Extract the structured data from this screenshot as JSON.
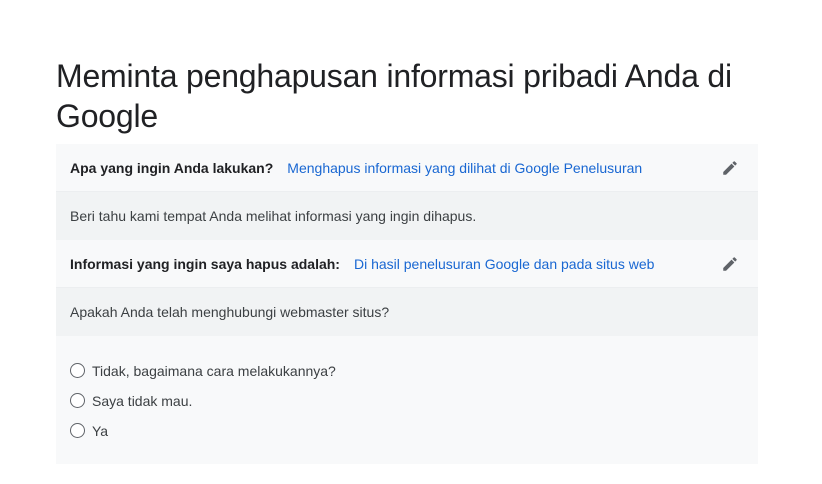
{
  "page": {
    "title": "Meminta penghapusan informasi pribadi Anda di Google"
  },
  "steps": [
    {
      "label": "Apa yang ingin Anda lakukan?",
      "value": "Menghapus informasi yang dilihat di Google Penelusuran",
      "edit_icon": "pencil-icon"
    },
    {
      "label": "Informasi yang ingin saya hapus adalah:",
      "value": "Di hasil penelusuran Google dan pada situs web",
      "edit_icon": "pencil-icon"
    }
  ],
  "prompts": {
    "where_seen": "Beri tahu kami tempat Anda melihat informasi yang ingin dihapus.",
    "webmaster_question": "Apakah Anda telah menghubungi webmaster situs?"
  },
  "options": [
    {
      "label": "Tidak, bagaimana cara melakukannya?",
      "selected": false
    },
    {
      "label": "Saya tidak mau.",
      "selected": false
    },
    {
      "label": "Ya",
      "selected": false
    }
  ],
  "colors": {
    "link": "#1967d2",
    "summary_bg": "#f8f9fa",
    "question_bg": "#f1f3f4",
    "icon": "#5f6368"
  }
}
